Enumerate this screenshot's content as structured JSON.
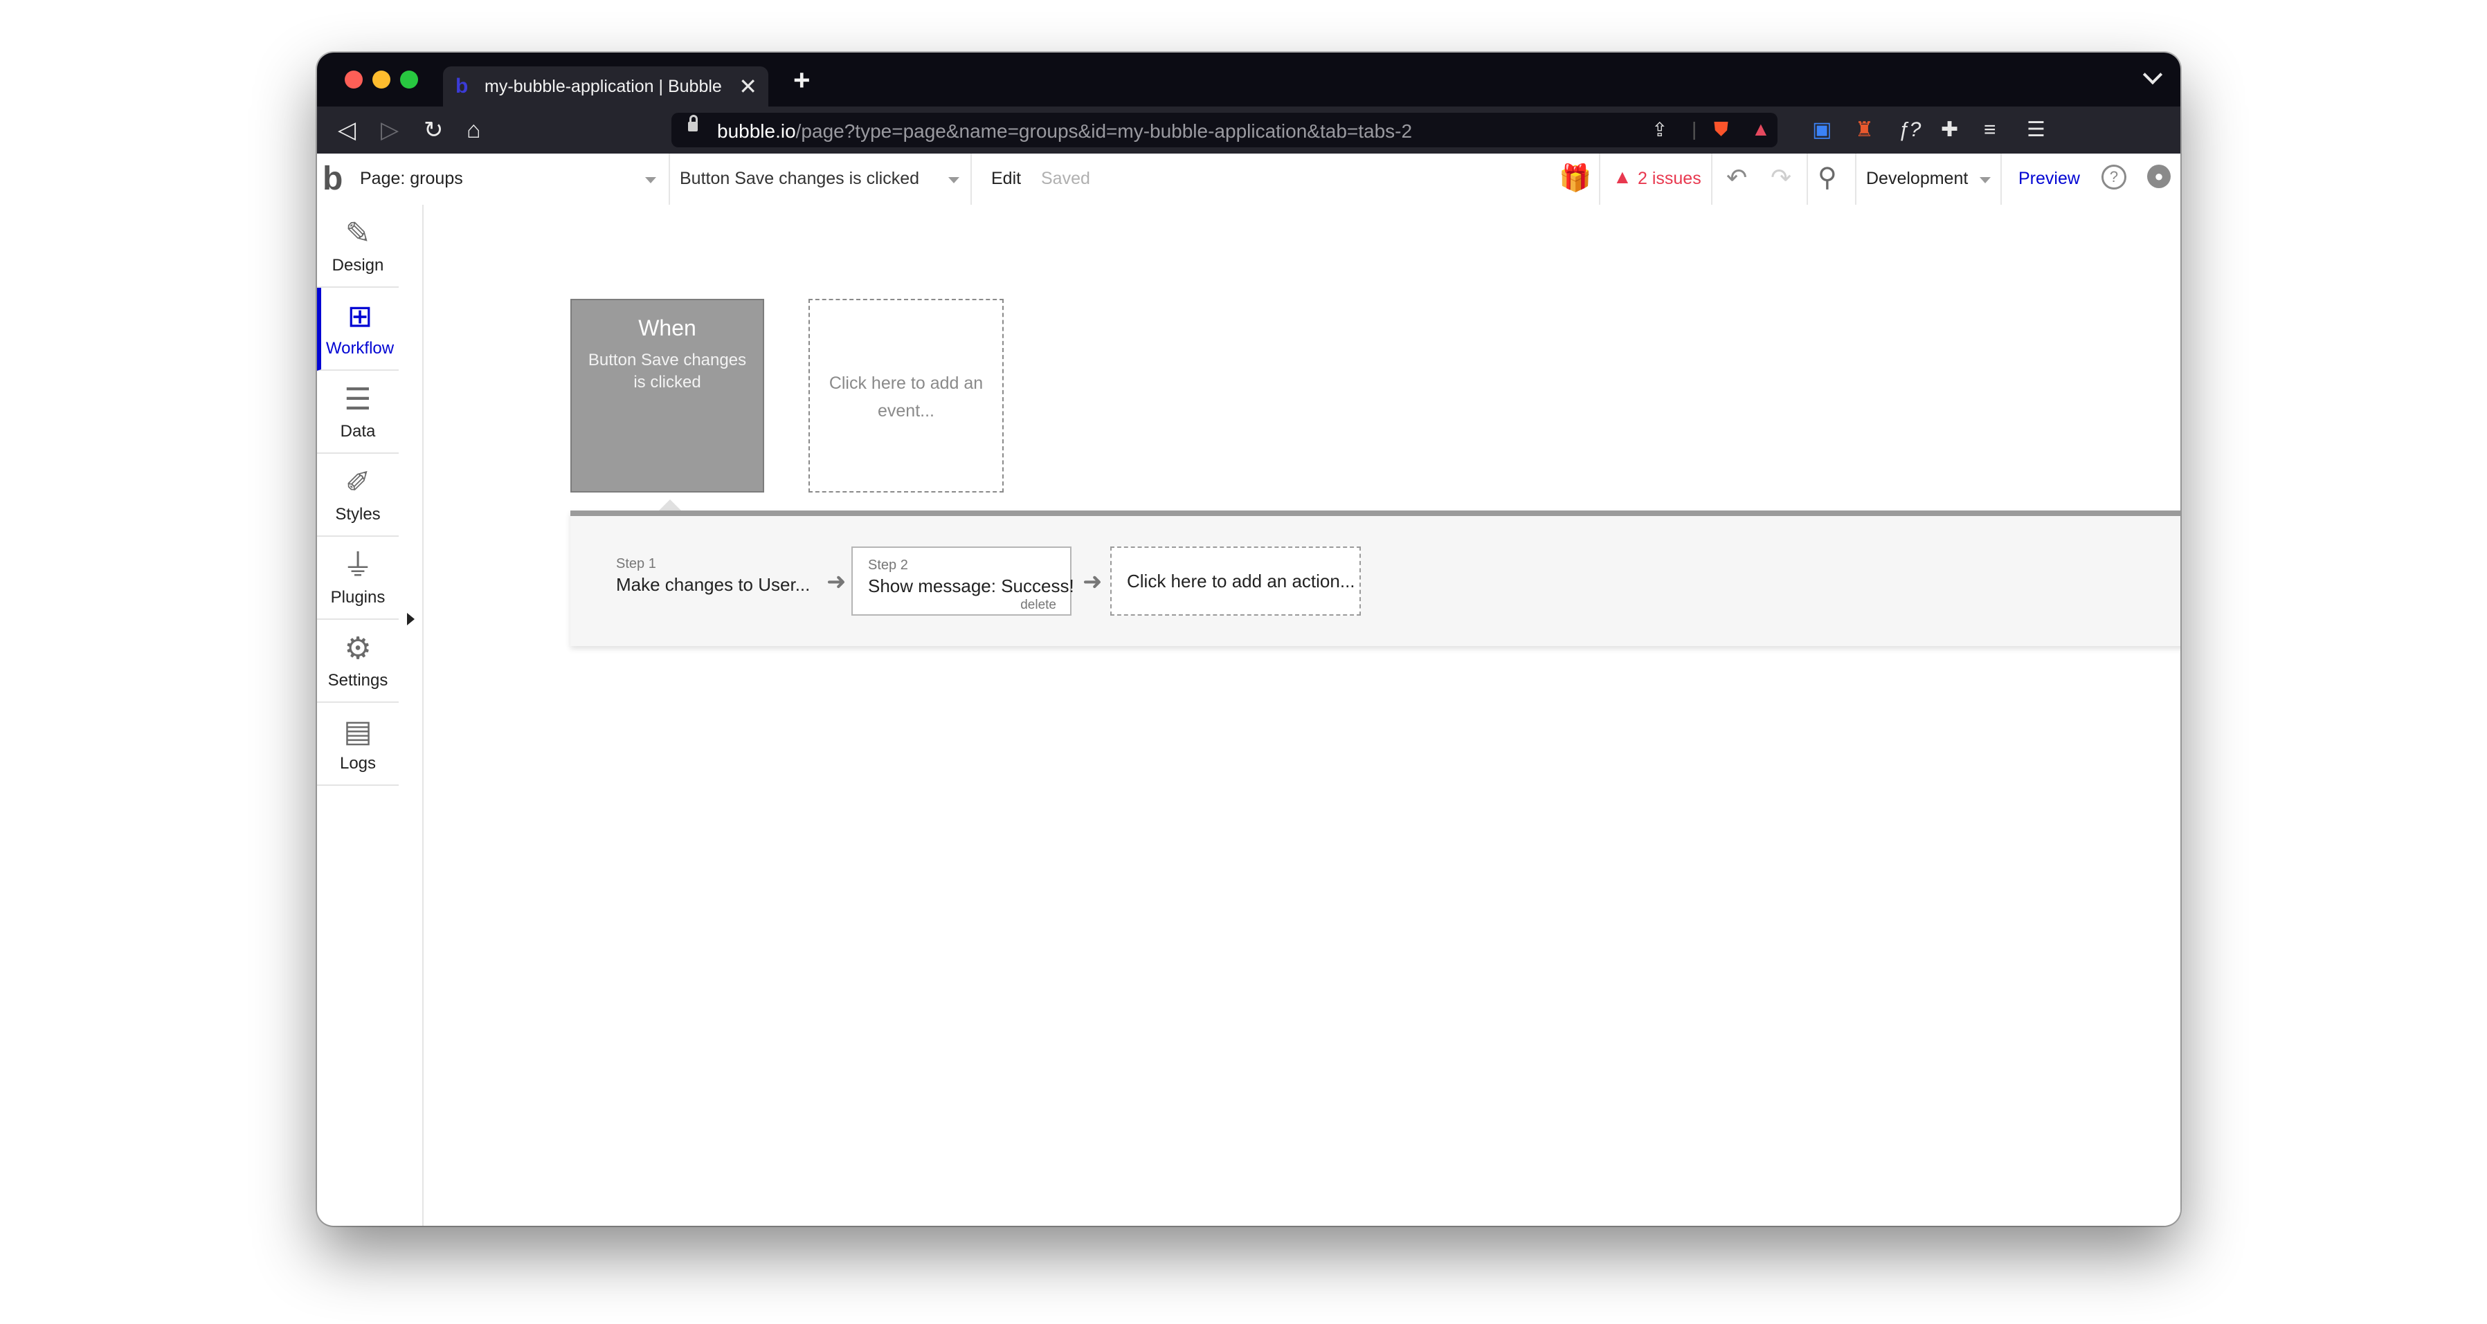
{
  "browser": {
    "tab_title": "my-bubble-application | Bubble",
    "tab_close": "✕",
    "new_tab": "+",
    "url_host": "bubble.io",
    "url_rest": "/page?type=page&name=groups&id=my-bubble-application&tab=tabs-2",
    "nav_back": "◁",
    "nav_forward": "▷",
    "nav_reload": "↻",
    "nav_home": "⌂",
    "icons": [
      "share-icon",
      "brave-shield-icon",
      "brave-rewards-icon",
      "bitwarden-icon",
      "extension-icon",
      "formula-icon",
      "puzzle-icon",
      "playlist-icon",
      "menu-icon"
    ]
  },
  "header": {
    "page_label": "Page: groups",
    "event_select": "Button Save changes is clicked",
    "edit_label": "Edit",
    "saved_label": "Saved",
    "issues_label": "2 issues",
    "env_label": "Development",
    "preview_label": "Preview",
    "issue_color": "#e8384f",
    "accent_color": "#0205d3"
  },
  "sidebar": {
    "items": [
      {
        "label": "Design",
        "icon": "design-icon"
      },
      {
        "label": "Workflow",
        "icon": "workflow-icon"
      },
      {
        "label": "Data",
        "icon": "database-icon"
      },
      {
        "label": "Styles",
        "icon": "brush-icon"
      },
      {
        "label": "Plugins",
        "icon": "plug-icon"
      },
      {
        "label": "Settings",
        "icon": "gear-icon"
      },
      {
        "label": "Logs",
        "icon": "document-icon"
      }
    ]
  },
  "workflow": {
    "event": {
      "when": "When",
      "name": "Button Save changes is clicked"
    },
    "add_event": "Click here to add an event...",
    "steps": [
      {
        "number": "Step 1",
        "name": "Make changes to User..."
      },
      {
        "number": "Step 2",
        "name": "Show message: Success!",
        "delete": "delete"
      }
    ],
    "add_action": "Click here to add an action..."
  }
}
